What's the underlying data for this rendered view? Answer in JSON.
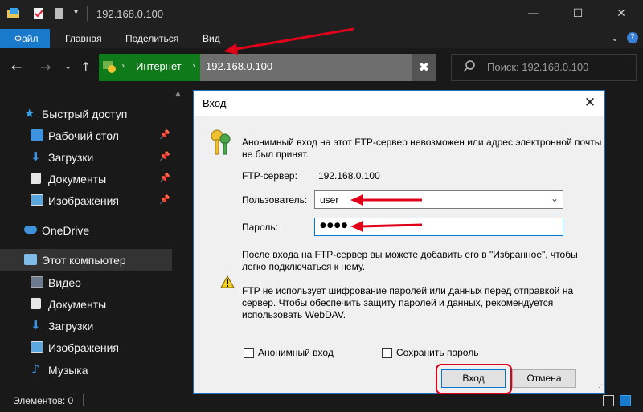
{
  "window": {
    "title": "192.168.0.100",
    "controls": [
      "minimize",
      "maximize",
      "close"
    ]
  },
  "ribbon": {
    "tabs": [
      "Файл",
      "Главная",
      "Поделиться",
      "Вид"
    ],
    "active_tab": "Файл",
    "accent_color": "#1979ca"
  },
  "address": {
    "segments": [
      "Интернет",
      "192.168.0.100"
    ],
    "search_placeholder": "Поиск: 192.168.0.100",
    "highlight_color": "#0f7a19"
  },
  "sidebar": {
    "quick_access": "Быстрый доступ",
    "quick_items": [
      {
        "label": "Рабочий стол",
        "icon": "desktop-icon",
        "pinned": true
      },
      {
        "label": "Загрузки",
        "icon": "download-icon",
        "pinned": true
      },
      {
        "label": "Документы",
        "icon": "document-icon",
        "pinned": true
      },
      {
        "label": "Изображения",
        "icon": "image-icon",
        "pinned": true
      }
    ],
    "onedrive": "OneDrive",
    "this_pc": "Этот компьютер",
    "pc_items": [
      {
        "label": "Видео",
        "icon": "video-icon"
      },
      {
        "label": "Документы",
        "icon": "document-icon"
      },
      {
        "label": "Загрузки",
        "icon": "download-icon"
      },
      {
        "label": "Изображения",
        "icon": "image-icon"
      },
      {
        "label": "Музыка",
        "icon": "music-icon"
      }
    ]
  },
  "status": {
    "elements": "Элементов: 0"
  },
  "dialog": {
    "title": "Вход",
    "info_text_1": "Анонимный вход на этот FTP-сервер невозможен или адрес электронной почты",
    "info_text_2": "не был принят.",
    "server_label": "FTP-сервер:",
    "server_value": "192.168.0.100",
    "user_label": "Пользователь:",
    "user_value": "user",
    "password_label": "Пароль:",
    "password_value": "●●●●",
    "favorites_text_1": "После входа на FTP-сервер вы можете добавить его в \"Избранное\", чтобы",
    "favorites_text_2": "легко подключаться к нему.",
    "warning_text_1": "FTP не использует шифрование паролей или данных перед отправкой на",
    "warning_text_2": "сервер. Чтобы обеспечить защиту паролей и данных, рекомендуется",
    "warning_text_3": "использовать WebDAV.",
    "anonymous_label": "Анонимный вход",
    "save_password_label": "Сохранить пароль",
    "login_button": "Вход",
    "cancel_button": "Отмена",
    "annotation_color": "#e1001a"
  }
}
